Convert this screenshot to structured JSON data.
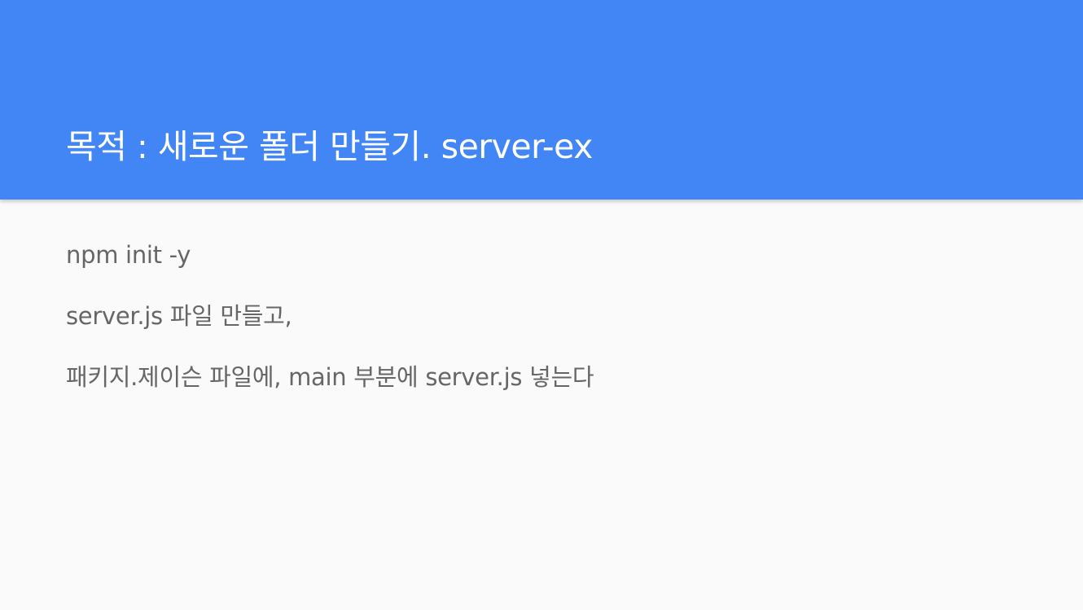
{
  "slide": {
    "title": "목적 : 새로운 폴더 만들기. server-ex",
    "lines": [
      "npm init -y",
      "server.js 파일 만들고,",
      "패키지.제이슨 파일에, main 부분에 server.js 넣는다"
    ]
  },
  "colors": {
    "header_background": "#4285f4",
    "title_text": "#ffffff",
    "body_text": "#666666",
    "page_background": "#fafafa"
  }
}
